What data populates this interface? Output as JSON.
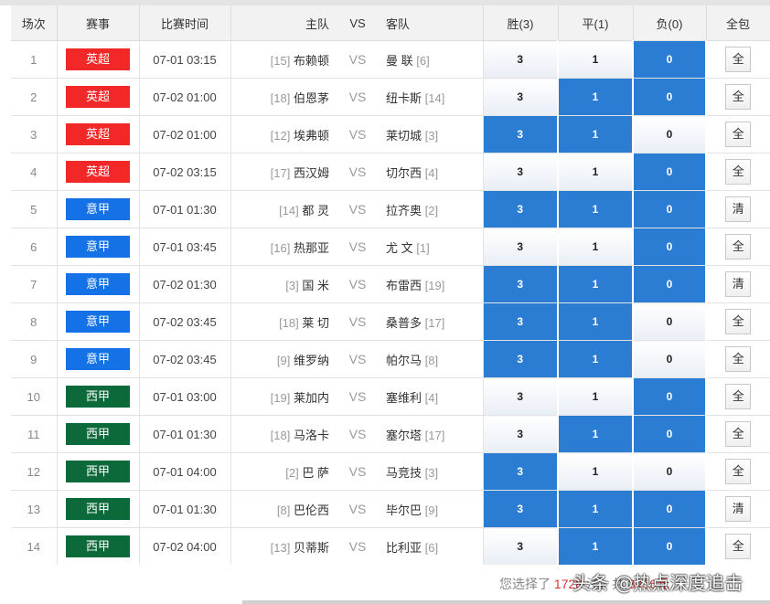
{
  "headers": {
    "index": "场次",
    "league": "赛事",
    "time": "比赛时间",
    "home": "主队",
    "vs": "VS",
    "away": "客队",
    "win": "胜(3)",
    "draw": "平(1)",
    "loss": "负(0)",
    "all": "全包"
  },
  "league_colors": {
    "英超": "#f22727",
    "意甲": "#1472e6",
    "西甲": "#0c6a3a"
  },
  "rows": [
    {
      "idx": "1",
      "league": "英超",
      "time": "07-01 03:15",
      "home_rank": "[15]",
      "home": "布赖顿",
      "vs": "VS",
      "away": "曼 联",
      "away_rank": "[6]",
      "win": "3",
      "draw": "1",
      "loss": "0",
      "win_sel": false,
      "draw_sel": false,
      "loss_sel": true,
      "btn": "全"
    },
    {
      "idx": "2",
      "league": "英超",
      "time": "07-02 01:00",
      "home_rank": "[18]",
      "home": "伯恩茅",
      "vs": "VS",
      "away": "纽卡斯",
      "away_rank": "[14]",
      "win": "3",
      "draw": "1",
      "loss": "0",
      "win_sel": false,
      "draw_sel": true,
      "loss_sel": true,
      "btn": "全"
    },
    {
      "idx": "3",
      "league": "英超",
      "time": "07-02 01:00",
      "home_rank": "[12]",
      "home": "埃弗顿",
      "vs": "VS",
      "away": "莱切城",
      "away_rank": "[3]",
      "win": "3",
      "draw": "1",
      "loss": "0",
      "win_sel": true,
      "draw_sel": true,
      "loss_sel": false,
      "btn": "全"
    },
    {
      "idx": "4",
      "league": "英超",
      "time": "07-02 03:15",
      "home_rank": "[17]",
      "home": "西汉姆",
      "vs": "VS",
      "away": "切尔西",
      "away_rank": "[4]",
      "win": "3",
      "draw": "1",
      "loss": "0",
      "win_sel": false,
      "draw_sel": false,
      "loss_sel": true,
      "btn": "全"
    },
    {
      "idx": "5",
      "league": "意甲",
      "time": "07-01 01:30",
      "home_rank": "[14]",
      "home": "都 灵",
      "vs": "VS",
      "away": "拉齐奥",
      "away_rank": "[2]",
      "win": "3",
      "draw": "1",
      "loss": "0",
      "win_sel": true,
      "draw_sel": true,
      "loss_sel": true,
      "btn": "清"
    },
    {
      "idx": "6",
      "league": "意甲",
      "time": "07-01 03:45",
      "home_rank": "[16]",
      "home": "热那亚",
      "vs": "VS",
      "away": "尤 文",
      "away_rank": "[1]",
      "win": "3",
      "draw": "1",
      "loss": "0",
      "win_sel": false,
      "draw_sel": false,
      "loss_sel": true,
      "btn": "全"
    },
    {
      "idx": "7",
      "league": "意甲",
      "time": "07-02 01:30",
      "home_rank": "[3]",
      "home": "国 米",
      "vs": "VS",
      "away": "布雷西",
      "away_rank": "[19]",
      "win": "3",
      "draw": "1",
      "loss": "0",
      "win_sel": true,
      "draw_sel": true,
      "loss_sel": true,
      "btn": "清"
    },
    {
      "idx": "8",
      "league": "意甲",
      "time": "07-02 03:45",
      "home_rank": "[18]",
      "home": "莱 切",
      "vs": "VS",
      "away": "桑普多",
      "away_rank": "[17]",
      "win": "3",
      "draw": "1",
      "loss": "0",
      "win_sel": true,
      "draw_sel": true,
      "loss_sel": false,
      "btn": "全"
    },
    {
      "idx": "9",
      "league": "意甲",
      "time": "07-02 03:45",
      "home_rank": "[9]",
      "home": "维罗纳",
      "vs": "VS",
      "away": "帕尔马",
      "away_rank": "[8]",
      "win": "3",
      "draw": "1",
      "loss": "0",
      "win_sel": true,
      "draw_sel": true,
      "loss_sel": false,
      "btn": "全"
    },
    {
      "idx": "10",
      "league": "西甲",
      "time": "07-01 03:00",
      "home_rank": "[19]",
      "home": "莱加内",
      "vs": "VS",
      "away": "塞维利",
      "away_rank": "[4]",
      "win": "3",
      "draw": "1",
      "loss": "0",
      "win_sel": false,
      "draw_sel": false,
      "loss_sel": true,
      "btn": "全"
    },
    {
      "idx": "11",
      "league": "西甲",
      "time": "07-01 01:30",
      "home_rank": "[18]",
      "home": "马洛卡",
      "vs": "VS",
      "away": "塞尔塔",
      "away_rank": "[17]",
      "win": "3",
      "draw": "1",
      "loss": "0",
      "win_sel": false,
      "draw_sel": true,
      "loss_sel": true,
      "btn": "全"
    },
    {
      "idx": "12",
      "league": "西甲",
      "time": "07-01 04:00",
      "home_rank": "[2]",
      "home": "巴 萨",
      "vs": "VS",
      "away": "马竞技",
      "away_rank": "[3]",
      "win": "3",
      "draw": "1",
      "loss": "0",
      "win_sel": true,
      "draw_sel": false,
      "loss_sel": false,
      "btn": "全"
    },
    {
      "idx": "13",
      "league": "西甲",
      "time": "07-01 01:30",
      "home_rank": "[8]",
      "home": "巴伦西",
      "vs": "VS",
      "away": "毕尔巴",
      "away_rank": "[9]",
      "win": "3",
      "draw": "1",
      "loss": "0",
      "win_sel": true,
      "draw_sel": true,
      "loss_sel": true,
      "btn": "清"
    },
    {
      "idx": "14",
      "league": "西甲",
      "time": "07-02 04:00",
      "home_rank": "[13]",
      "home": "贝蒂斯",
      "vs": "VS",
      "away": "比利亚",
      "away_rank": "[6]",
      "win": "3",
      "draw": "1",
      "loss": "0",
      "win_sel": false,
      "draw_sel": true,
      "loss_sel": true,
      "btn": "全"
    }
  ],
  "footer": {
    "prefix": "您选择了",
    "count": "1728",
    "suffix": "注，共",
    "amount": "3456元"
  },
  "watermark": "头条 @热点深度追击"
}
